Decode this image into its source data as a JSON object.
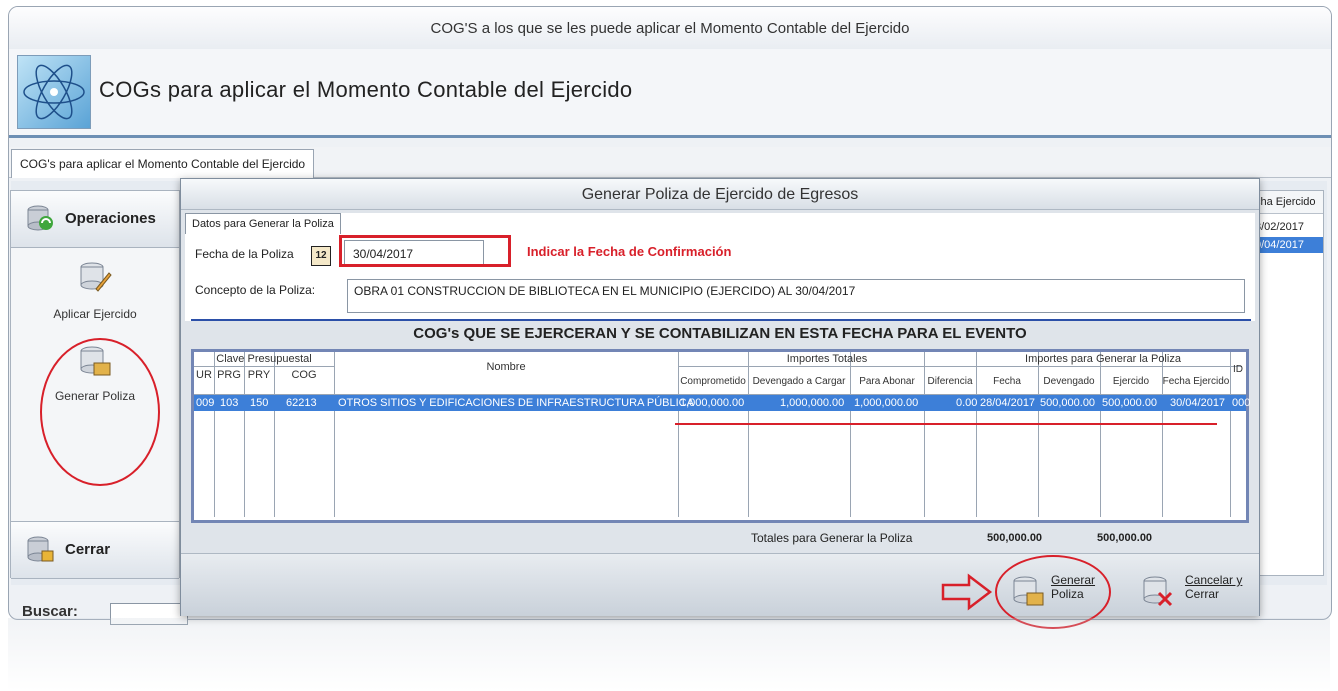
{
  "window": {
    "title": "COG'S a los que se les puede aplicar el Momento Contable del Ejercido",
    "header_title": "COGs para aplicar el Momento Contable del Ejercido",
    "tab_label": "COG's para aplicar el Momento Contable del Ejercido"
  },
  "sidebar": {
    "operations_label": "Operaciones",
    "items": [
      {
        "label": "Aplicar Ejercido",
        "icon": "db-edit-icon"
      },
      {
        "label": "Generar Poliza",
        "icon": "db-generate-icon"
      }
    ],
    "close_label": "Cerrar"
  },
  "background_grid": {
    "header": "cha Ejercido",
    "rows": [
      "3/02/2017",
      "0/04/2017"
    ]
  },
  "search": {
    "label": "Buscar:"
  },
  "modal": {
    "title": "Generar Poliza de Ejercido de Egresos",
    "form_tab": "Datos para Generar la Poliza",
    "date_label": "Fecha de la Poliza",
    "date_icon": "12",
    "date_value": "30/04/2017",
    "annotation": "Indicar la Fecha de Confirmación",
    "concept_label": "Concepto de la Poliza:",
    "concept_value": "OBRA 01 CONSTRUCCION DE BIBLIOTECA EN EL MUNICIPIO (EJERCIDO) AL 30/04/2017",
    "grid_heading": "COG's QUE SE EJERCERAN Y SE CONTABILIZAN EN ESTA FECHA PARA EL EVENTO",
    "grid": {
      "group_headers": [
        "Clave Presupuestal",
        "Importes Totales",
        "Importes para Generar la Poliza"
      ],
      "columns": [
        "UR",
        "PRG",
        "PRY",
        "COG",
        "Nombre",
        "Comprometido",
        "Devengado a Cargar",
        "Para Abonar",
        "Diferencia",
        "Fecha",
        "Devengado",
        "Ejercido",
        "Fecha Ejercido",
        "ID"
      ],
      "row": {
        "ur": "009",
        "prg": "103",
        "pry": "150",
        "cog": "62213",
        "nombre": "OTROS SITIOS Y EDIFICACIONES DE INFRAESTRUCTURA PÚBLICA",
        "comprometido": "1,000,000.00",
        "devengado_cargar": "1,000,000.00",
        "para_abonar": "1,000,000.00",
        "diferencia": "0.00",
        "fecha": "28/04/2017",
        "devengado": "500,000.00",
        "ejercido": "500,000.00",
        "fecha_ejercido": "30/04/2017",
        "id": "000"
      }
    },
    "totals_label": "Totales para Generar la Poliza",
    "total_devengado": "500,000.00",
    "total_ejercido": "500,000.00",
    "generate_button": {
      "line1": "Generar",
      "line2": "Poliza"
    },
    "cancel_button": {
      "line1": "Cancelar y",
      "line2": "Cerrar"
    }
  },
  "colors": {
    "accent": "#3d7fd8",
    "annotation_red": "#d8202a",
    "separator_blue": "#2b4fa8"
  }
}
